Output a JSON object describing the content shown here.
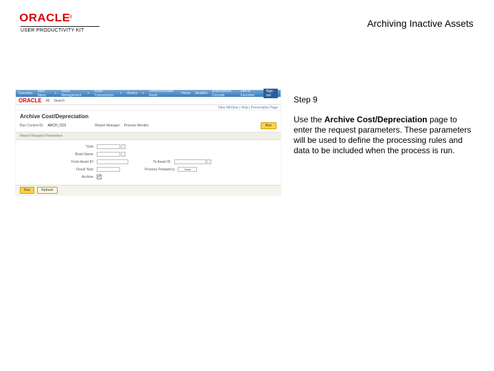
{
  "brand": {
    "name": "ORACLE",
    "tm": "®",
    "sub": "USER PRODUCTIVITY KIT"
  },
  "page_title": "Archiving Inactive Assets",
  "instructions": {
    "step": "Step 9",
    "body_pre": "Use the ",
    "body_bold": "Archive Cost/Depreciation",
    "body_post": " page to enter the request parameters. These parameters will be used to define the processing rules and data to be included when the process is run."
  },
  "app": {
    "header": {
      "items": [
        "Favorites",
        "Main Menu",
        "Asset Management",
        "Asset Transactions",
        "History",
        "Retire/Reinstate Asset"
      ],
      "sep": ">",
      "home": "Home",
      "worklist": "Worklist",
      "mcl": "Multichannel Console",
      "del": "Add to Favorites",
      "signout": "Sign out"
    },
    "sub": {
      "logo": "ORACLE",
      "tabs": [
        "All",
        "Search",
        "",
        ""
      ]
    },
    "utility": "New Window | Help | Personalize Page",
    "title": "Archive Cost/Depreciation",
    "run": {
      "runctl_lbl": "Run Control ID:",
      "runctl_val": "ARCH_CD1",
      "report_lbl": "Report Manager",
      "procmon_lbl": "Process Monitor",
      "btn": "Run"
    },
    "subhead": "Report Request Parameters",
    "form": {
      "unit_lbl": "*Unit:",
      "book_lbl": "Book Name:",
      "from_lbl": "From Asset ID:",
      "to_lbl": "To Asset ID:",
      "process_freq_lbl": "Process Frequency:",
      "archive_lbl": "Archive:",
      "fy_lbl": "Fiscal Year:",
      "process_freq_val": "Once"
    },
    "footer": {
      "run": "Run",
      "refresh": "Refresh"
    }
  }
}
